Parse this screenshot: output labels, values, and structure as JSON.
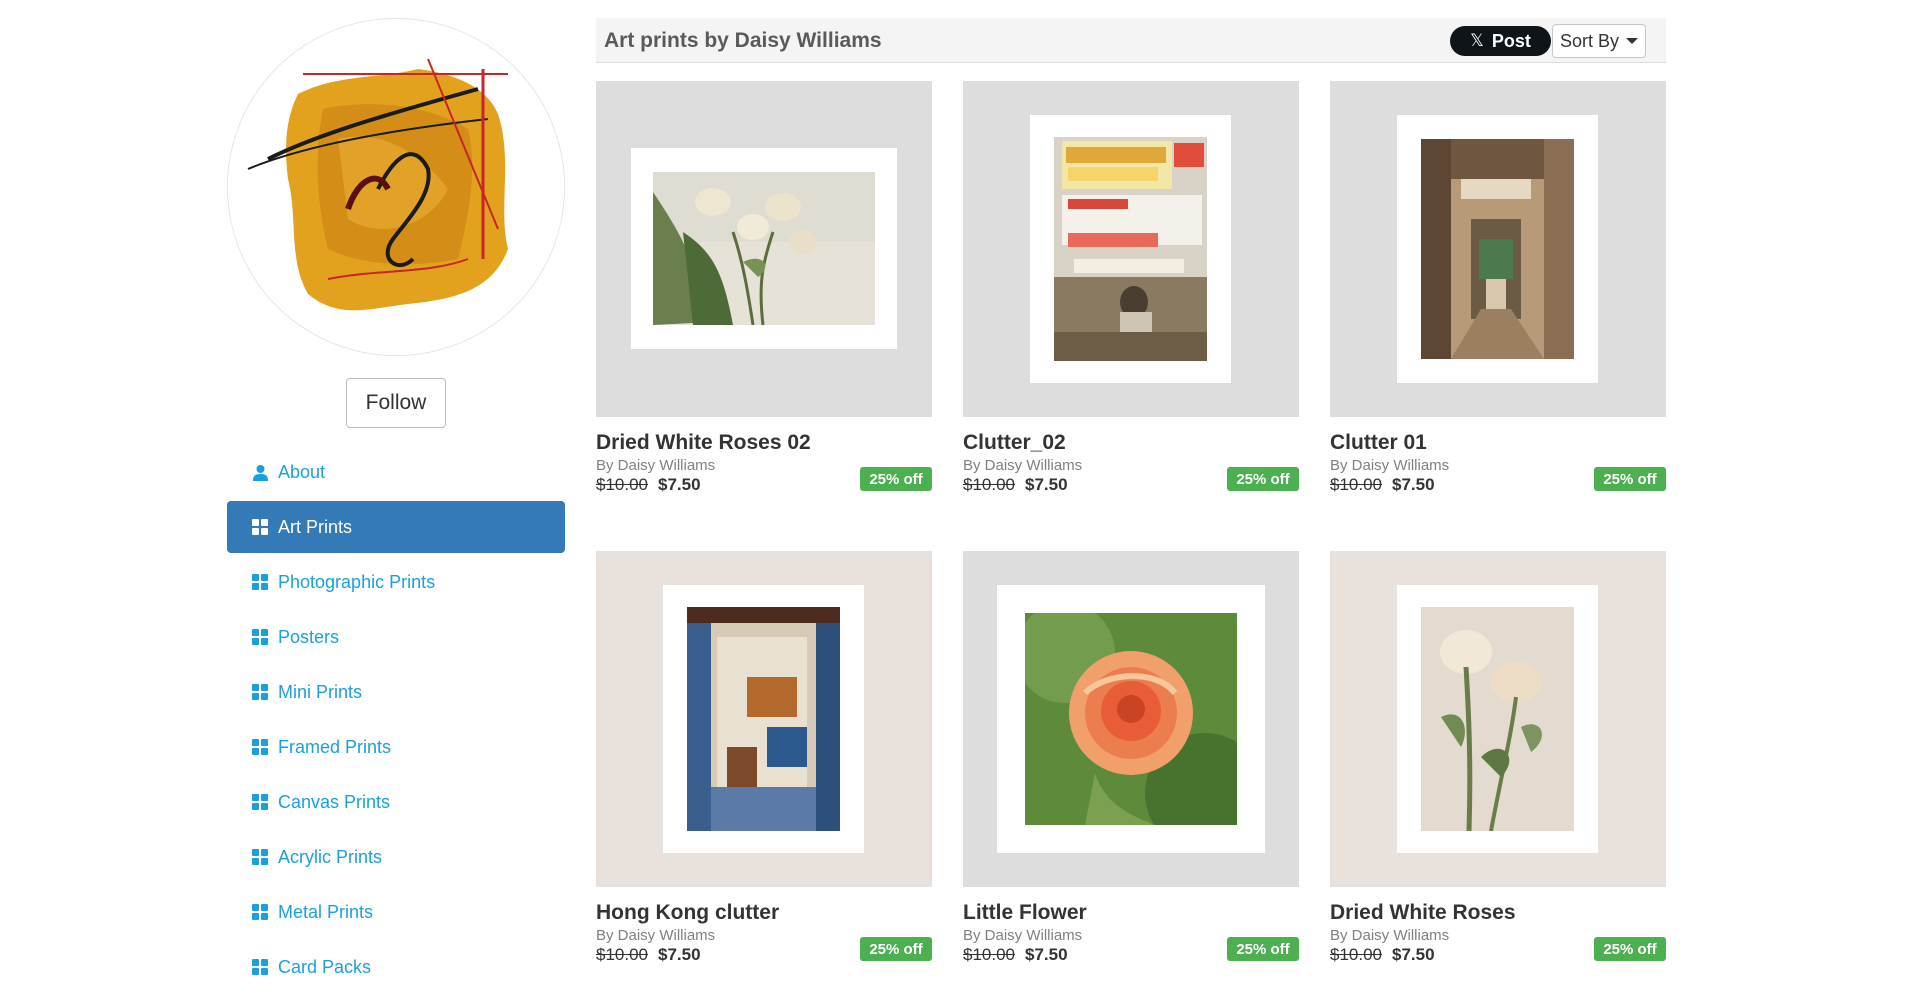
{
  "sidebar": {
    "follow_label": "Follow",
    "nav": [
      {
        "label": "About",
        "icon": "user-icon"
      },
      {
        "label": "Art Prints",
        "icon": "grid-icon",
        "active": true
      },
      {
        "label": "Photographic Prints",
        "icon": "grid-icon"
      },
      {
        "label": "Posters",
        "icon": "grid-icon"
      },
      {
        "label": "Mini Prints",
        "icon": "grid-icon"
      },
      {
        "label": "Framed Prints",
        "icon": "grid-icon"
      },
      {
        "label": "Canvas Prints",
        "icon": "grid-icon"
      },
      {
        "label": "Acrylic Prints",
        "icon": "grid-icon"
      },
      {
        "label": "Metal Prints",
        "icon": "grid-icon"
      },
      {
        "label": "Card Packs",
        "icon": "grid-icon"
      }
    ]
  },
  "header": {
    "title": "Art prints by Daisy Williams",
    "post_label": "Post",
    "sort_label": "Sort By"
  },
  "products": [
    {
      "title": "Dried White Roses 02",
      "artist": "By Daisy Williams",
      "old_price": "$10.00",
      "new_price": "$7.50",
      "badge": "25% off"
    },
    {
      "title": "Clutter_02",
      "artist": "By Daisy Williams",
      "old_price": "$10.00",
      "new_price": "$7.50",
      "badge": "25% off"
    },
    {
      "title": "Clutter 01",
      "artist": "By Daisy Williams",
      "old_price": "$10.00",
      "new_price": "$7.50",
      "badge": "25% off"
    },
    {
      "title": "Hong Kong clutter",
      "artist": "By Daisy Williams",
      "old_price": "$10.00",
      "new_price": "$7.50",
      "badge": "25% off"
    },
    {
      "title": "Little Flower",
      "artist": "By Daisy Williams",
      "old_price": "$10.00",
      "new_price": "$7.50",
      "badge": "25% off"
    },
    {
      "title": "Dried White Roses",
      "artist": "By Daisy Williams",
      "old_price": "$10.00",
      "new_price": "$7.50",
      "badge": "25% off"
    }
  ],
  "colors": {
    "link": "#1a9fe0",
    "active_nav": "#337ab7",
    "badge": "#4caf50",
    "thumb_bg_grey": "#dddddd",
    "thumb_bg_beige": "#e9e1dc"
  }
}
